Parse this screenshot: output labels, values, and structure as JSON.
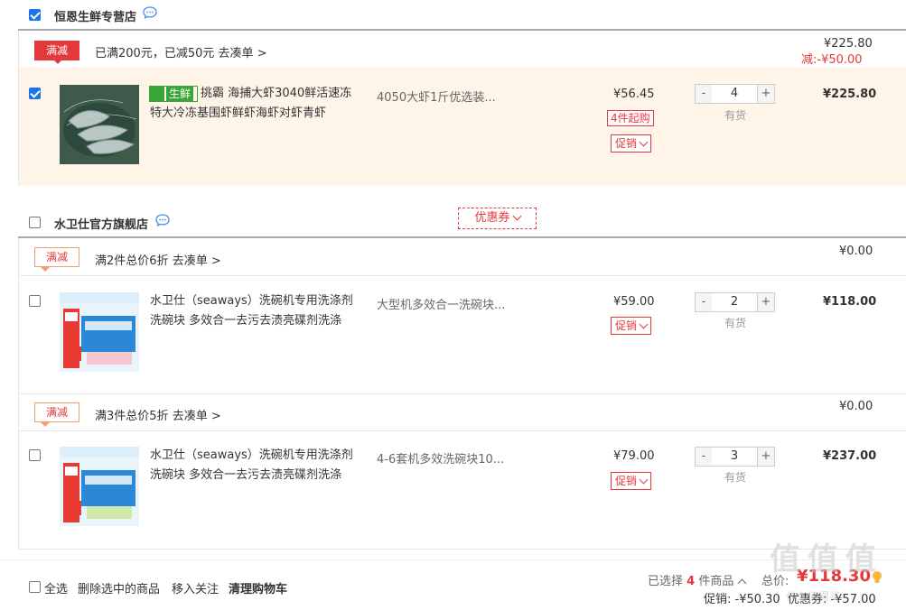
{
  "colors": {
    "accent": "#e4393c",
    "checkbox": "#1a73e8",
    "highlight_row": "#fff4e8"
  },
  "shops": [
    {
      "name": "恒恩生鲜专营店",
      "checked": true,
      "promo": {
        "tag": "满减",
        "text": "已满200元，已减50元",
        "link": "去凑单 >"
      },
      "subtotal": "¥225.80",
      "discount_label": "减:",
      "discount": "-¥50.00",
      "items": [
        {
          "fresh_badge": "生鲜",
          "title": "挑霸 海捕大虾3040鲜活速冻特大冷冻基围虾鲜虾海虾对虾青虾",
          "spec": "4050大虾1斤优选装...",
          "price": "¥56.45",
          "min_tag": "4件起购",
          "promo_btn": "促销",
          "qty": "4",
          "stock": "有货",
          "total": "¥225.80"
        }
      ]
    },
    {
      "name": "水卫仕官方旗舰店",
      "checked": false,
      "coupon": "优惠券",
      "groups": [
        {
          "promo": {
            "tag": "满减",
            "text": "满2件总价6折",
            "link": "去凑单 >"
          },
          "subtotal": "¥0.00",
          "item": {
            "title": "水卫仕（seaways）洗碗机专用洗涤剂洗碗块 多效合一去污去渍亮碟剂洗涤",
            "spec": "大型机多效合一洗碗块...",
            "price": "¥59.00",
            "promo_btn": "促销",
            "qty": "2",
            "stock": "有货",
            "total": "¥118.00"
          }
        },
        {
          "promo": {
            "tag": "满减",
            "text": "满3件总价5折",
            "link": "去凑单 >"
          },
          "subtotal": "¥0.00",
          "item": {
            "title": "水卫仕（seaways）洗碗机专用洗涤剂洗碗块 多效合一去污去渍亮碟剂洗涤",
            "spec": "4-6套机多效洗碗块10...",
            "price": "¥79.00",
            "promo_btn": "促销",
            "qty": "3",
            "stock": "有货",
            "total": "¥237.00"
          }
        }
      ]
    }
  ],
  "qty_buttons": {
    "minus": "-",
    "plus": "+"
  },
  "footer": {
    "select_all": "全选",
    "delete_selected": "删除选中的商品",
    "move_to_follow": "移入关注",
    "clear_cart": "清理购物车",
    "selected_prefix": "已选择",
    "selected_count": "4",
    "selected_suffix": "件商品",
    "total_label": "总价:",
    "total": "¥118.30",
    "promo_line": "促销: -¥50.30  优惠券: -¥57.00"
  },
  "watermark": "值 值 值",
  "watermark_sub": "什么值得买"
}
